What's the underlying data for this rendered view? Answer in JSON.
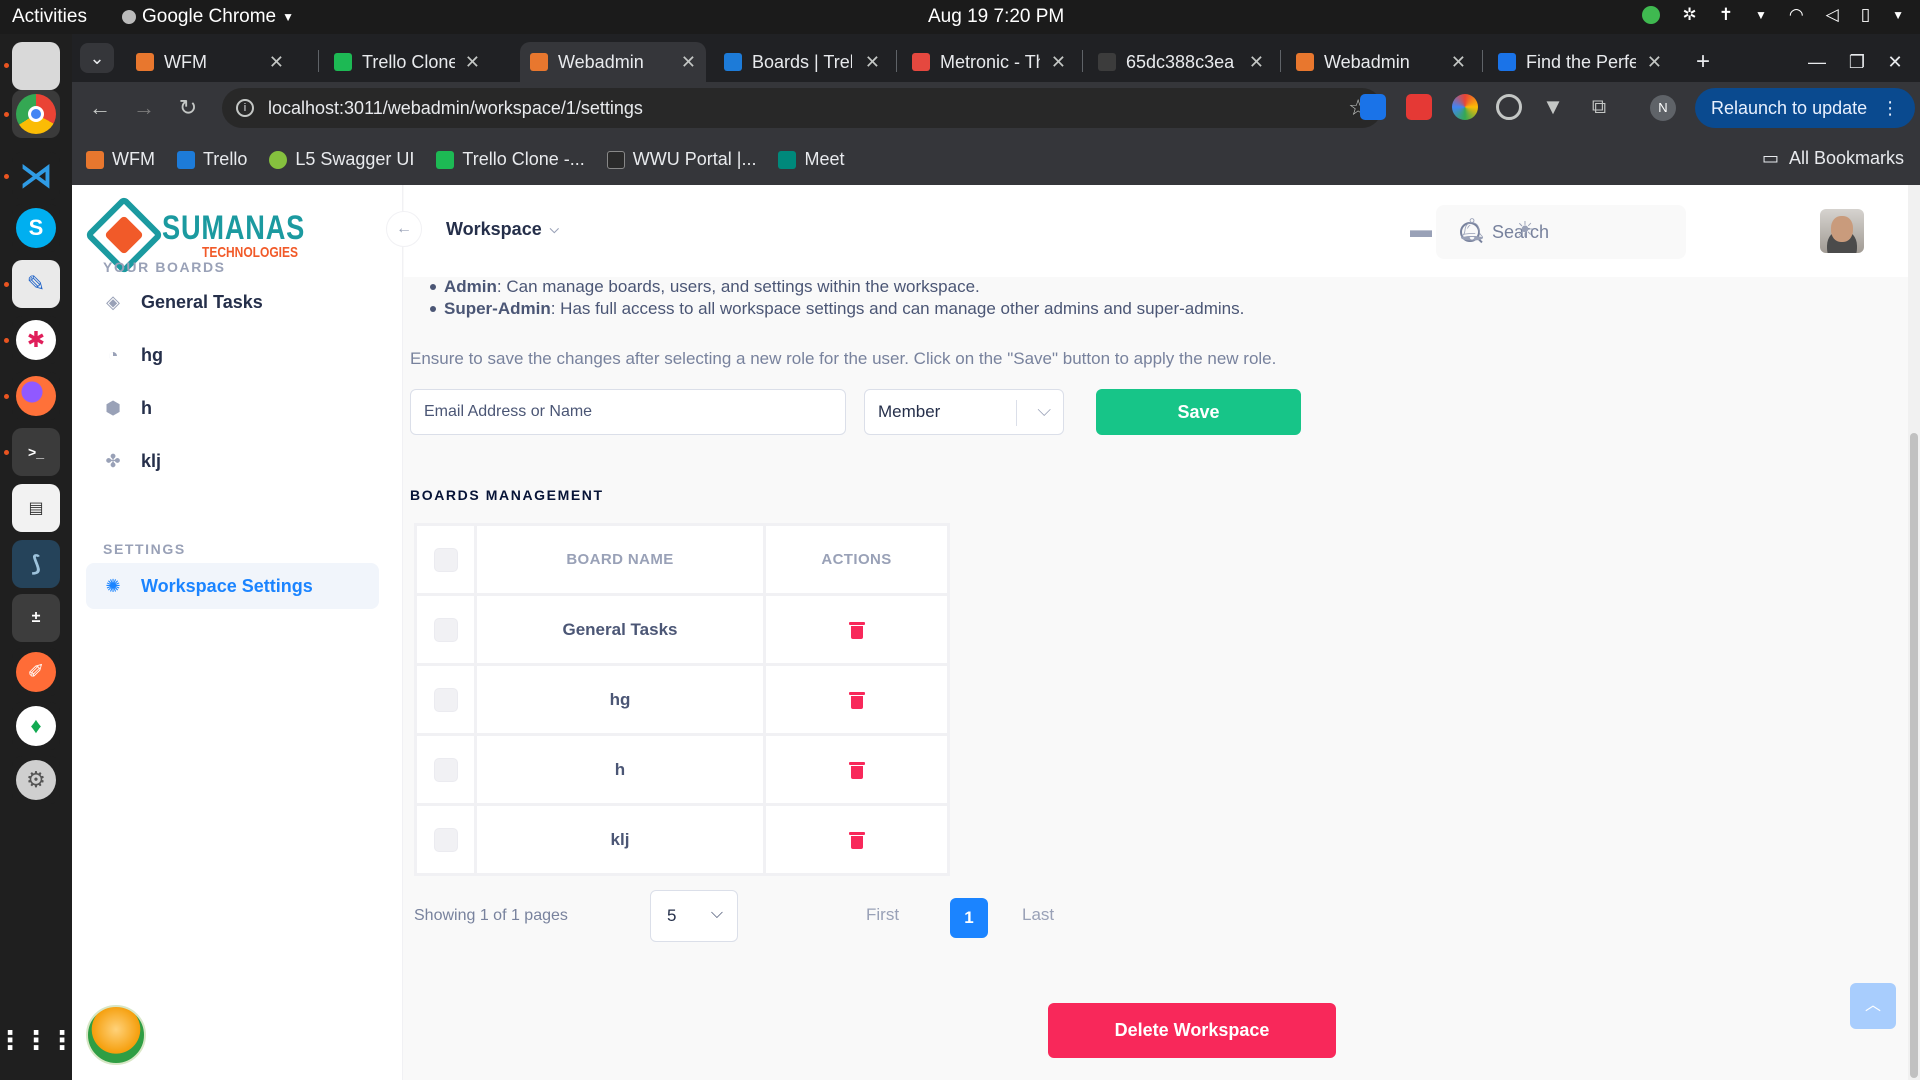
{
  "os": {
    "activities": "Activities",
    "app_menu": "Google Chrome",
    "clock": "Aug 19  7:20 PM"
  },
  "chrome": {
    "tabs": [
      {
        "title": "WFM",
        "favicon": "#e8772e"
      },
      {
        "title": "Trello Clone",
        "favicon": "#1db954"
      },
      {
        "title": "Webadmin",
        "favicon": "#e8772e"
      },
      {
        "title": "Boards | Trello",
        "favicon": "#1d7bd8"
      },
      {
        "title": "Metronic - The",
        "favicon": "#e5483f"
      },
      {
        "title": "65dc388c3ea",
        "favicon": "#3c3c3c"
      },
      {
        "title": "Webadmin",
        "favicon": "#e8772e"
      },
      {
        "title": "Find the Perfect",
        "favicon": "#1a73e8"
      }
    ],
    "new_tab": "+",
    "url": "localhost:3011/webadmin/workspace/1/settings",
    "profile_initial": "N",
    "relaunch_label": "Relaunch to update",
    "bookmarks": [
      {
        "label": "WFM",
        "color": "#e8772e"
      },
      {
        "label": "Trello",
        "color": "#1d7bd8"
      },
      {
        "label": "L5 Swagger UI",
        "color": "#85c13e"
      },
      {
        "label": "Trello Clone -...",
        "color": "#1db954"
      },
      {
        "label": "WWU Portal |...",
        "color": "#2a2a2a"
      },
      {
        "label": "Meet",
        "color": "#00897b"
      }
    ],
    "all_bookmarks": "All Bookmarks"
  },
  "sidebar": {
    "logo_line1": "SUMANAS",
    "logo_line2": "TECHNOLOGIES",
    "boards_heading": "YOUR BOARDS",
    "boards": [
      {
        "label": "General Tasks",
        "icon": "diamond-icon"
      },
      {
        "label": "hg",
        "icon": "ring-icon"
      },
      {
        "label": "h",
        "icon": "cube-icon"
      },
      {
        "label": "klj",
        "icon": "grid-icon"
      }
    ],
    "settings_heading": "SETTINGS",
    "settings_item": "Workspace Settings"
  },
  "header": {
    "workspace_label": "Workspace",
    "search_label": "Search"
  },
  "content": {
    "roles": [
      {
        "name": "Admin",
        "desc": ": Can manage boards, users, and settings within the workspace."
      },
      {
        "name": "Super-Admin",
        "desc": ": Has full access to all workspace settings and can manage other admins and super-admins."
      }
    ],
    "note": "Ensure to save the changes after selecting a new role for the user. Click on the \"Save\" button to apply the new role.",
    "email_placeholder": "Email Address or Name",
    "role_value": "Member",
    "save_label": "Save",
    "boards_heading": "BOARDS MANAGEMENT",
    "table": {
      "headers": [
        "BOARD NAME",
        "ACTIONS"
      ],
      "rows": [
        "General Tasks",
        "hg",
        "h",
        "klj"
      ]
    },
    "pager": {
      "info": "Showing 1 of 1 pages",
      "page_size": "5",
      "first": "First",
      "current": "1",
      "last": "Last"
    },
    "delete_label": "Delete Workspace"
  }
}
